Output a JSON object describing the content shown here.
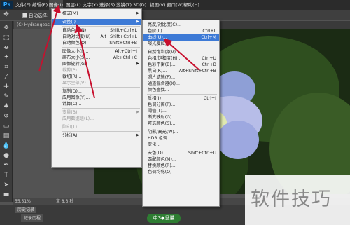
{
  "app_logo": "Ps",
  "menubar": [
    "文件(F)",
    "编辑(E)",
    "图像(I)",
    "图层(L)",
    "文字(Y)",
    "选择(S)",
    "滤镜(T)",
    "3D(D)",
    "视图(V)",
    "窗口(W)",
    "帮助(H)"
  ],
  "optbar": {
    "auto_select_label": "自动选择:"
  },
  "doc_tab": "(C) Hydrangeas.jpg",
  "status": {
    "zoom": "55.51%",
    "doc_info": "文 8.3 秒"
  },
  "history": {
    "panel_tab": "历史记录",
    "note_tab": "记录历程"
  },
  "image_menu": [
    {
      "label": "模式(M)",
      "shortcut": "",
      "arrow": true,
      "disabled": false,
      "hl": false
    },
    {
      "sep": true
    },
    {
      "label": "调整(J)",
      "shortcut": "",
      "arrow": true,
      "disabled": false,
      "hl": true
    },
    {
      "sep": true
    },
    {
      "label": "自动色调(N)",
      "shortcut": "Shift+Ctrl+L",
      "arrow": false,
      "disabled": false,
      "hl": false
    },
    {
      "label": "自动对比度(U)",
      "shortcut": "Alt+Shift+Ctrl+L",
      "arrow": false,
      "disabled": false,
      "hl": false
    },
    {
      "label": "自动颜色(O)",
      "shortcut": "Shift+Ctrl+B",
      "arrow": false,
      "disabled": false,
      "hl": false
    },
    {
      "sep": true
    },
    {
      "label": "图像大小(I)...",
      "shortcut": "Alt+Ctrl+I",
      "arrow": false,
      "disabled": false,
      "hl": false
    },
    {
      "label": "画布大小(S)...",
      "shortcut": "Alt+Ctrl+C",
      "arrow": false,
      "disabled": false,
      "hl": false
    },
    {
      "label": "图像旋转(G)",
      "shortcut": "",
      "arrow": true,
      "disabled": false,
      "hl": false
    },
    {
      "label": "裁剪(P)",
      "shortcut": "",
      "arrow": false,
      "disabled": true,
      "hl": false
    },
    {
      "label": "裁切(R)...",
      "shortcut": "",
      "arrow": false,
      "disabled": false,
      "hl": false
    },
    {
      "label": "显示全部(V)",
      "shortcut": "",
      "arrow": false,
      "disabled": true,
      "hl": false
    },
    {
      "sep": true
    },
    {
      "label": "复制(D)...",
      "shortcut": "",
      "arrow": false,
      "disabled": false,
      "hl": false
    },
    {
      "label": "应用图像(Y)...",
      "shortcut": "",
      "arrow": false,
      "disabled": false,
      "hl": false
    },
    {
      "label": "计算(C)...",
      "shortcut": "",
      "arrow": false,
      "disabled": false,
      "hl": false
    },
    {
      "sep": true
    },
    {
      "label": "变量(B)",
      "shortcut": "",
      "arrow": true,
      "disabled": true,
      "hl": false
    },
    {
      "label": "应用数据组(L)...",
      "shortcut": "",
      "arrow": false,
      "disabled": true,
      "hl": false
    },
    {
      "sep": true
    },
    {
      "label": "陷印(T)...",
      "shortcut": "",
      "arrow": false,
      "disabled": true,
      "hl": false
    },
    {
      "sep": true
    },
    {
      "label": "分析(A)",
      "shortcut": "",
      "arrow": true,
      "disabled": false,
      "hl": false
    }
  ],
  "sub_menu": [
    {
      "label": "亮度/对比度(C)...",
      "shortcut": "",
      "hl": false
    },
    {
      "label": "色阶(L)...",
      "shortcut": "Ctrl+L",
      "hl": false
    },
    {
      "label": "曲线(U)...",
      "shortcut": "Ctrl+M",
      "hl": true
    },
    {
      "label": "曝光度(E)...",
      "shortcut": "",
      "hl": false
    },
    {
      "sep": true
    },
    {
      "label": "自然饱和度(V)...",
      "shortcut": "",
      "hl": false
    },
    {
      "label": "色相/饱和度(H)...",
      "shortcut": "Ctrl+U",
      "hl": false
    },
    {
      "label": "色彩平衡(B)...",
      "shortcut": "Ctrl+B",
      "hl": false
    },
    {
      "label": "黑白(K)...",
      "shortcut": "Alt+Shift+Ctrl+B",
      "hl": false
    },
    {
      "label": "照片滤镜(F)...",
      "shortcut": "",
      "hl": false
    },
    {
      "label": "通道混合器(X)...",
      "shortcut": "",
      "hl": false
    },
    {
      "label": "颜色查找...",
      "shortcut": "",
      "hl": false
    },
    {
      "sep": true
    },
    {
      "label": "反相(I)",
      "shortcut": "Ctrl+I",
      "hl": false
    },
    {
      "label": "色调分离(P)...",
      "shortcut": "",
      "hl": false
    },
    {
      "label": "阈值(T)...",
      "shortcut": "",
      "hl": false
    },
    {
      "label": "渐变映射(G)...",
      "shortcut": "",
      "hl": false
    },
    {
      "label": "可选颜色(S)...",
      "shortcut": "",
      "hl": false
    },
    {
      "sep": true
    },
    {
      "label": "阴影/高光(W)...",
      "shortcut": "",
      "hl": false
    },
    {
      "label": "HDR 色调...",
      "shortcut": "",
      "hl": false
    },
    {
      "label": "变化...",
      "shortcut": "",
      "hl": false
    },
    {
      "sep": true
    },
    {
      "label": "去色(D)",
      "shortcut": "Shift+Ctrl+U",
      "hl": false
    },
    {
      "label": "匹配颜色(M)...",
      "shortcut": "",
      "hl": false
    },
    {
      "label": "替换颜色(R)...",
      "shortcut": "",
      "hl": false
    },
    {
      "label": "色调均化(Q)",
      "shortcut": "",
      "hl": false
    }
  ],
  "badge": "中3◆息量",
  "watermark": "软件技巧",
  "colors": {
    "highlight": "#3d7ad6",
    "arrow": "#c8102e"
  }
}
